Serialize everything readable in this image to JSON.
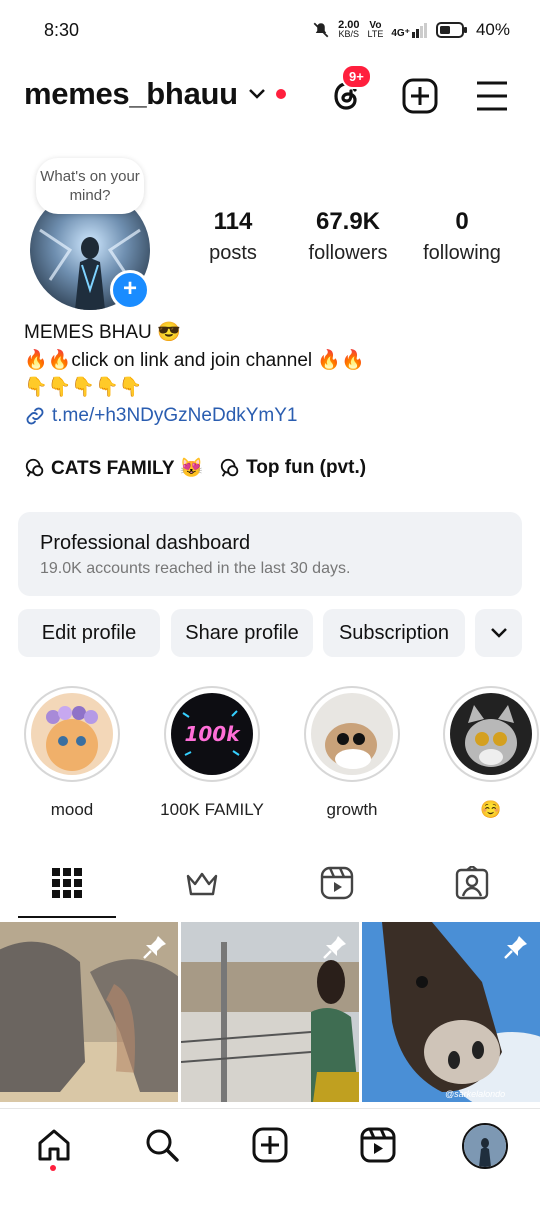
{
  "status_bar": {
    "time": "8:30",
    "speed_value": "2.00",
    "speed_unit": "KB/S",
    "volte_top": "Vo",
    "volte_bottom": "LTE",
    "network": "4G⁺",
    "battery": "40%"
  },
  "header": {
    "username": "memes_bhauu",
    "threads_badge": "9+",
    "icons": [
      "chevron-down-icon",
      "threads-icon",
      "add-post-icon",
      "menu-icon"
    ]
  },
  "profile": {
    "note_bubble": "What's on your mind?",
    "stats": [
      {
        "value": "114",
        "label": "posts"
      },
      {
        "value": "67.9K",
        "label": "followers"
      },
      {
        "value": "0",
        "label": "following"
      }
    ],
    "bio_name": "MEMES BHAU 😎",
    "bio_line1": "🔥🔥click on link and join channel 🔥🔥",
    "bio_line2": "👇👇👇👇👇",
    "bio_link": "t.me/+h3NDyGzNeDdkYmY1",
    "channels": [
      {
        "label": "CATS FAMILY 😻"
      },
      {
        "label": "Top fun (pvt.)"
      }
    ]
  },
  "dashboard": {
    "title": "Professional dashboard",
    "subtitle": "19.0K accounts reached in the last 30 days."
  },
  "actions": {
    "edit_label": "Edit profile",
    "share_label": "Share profile",
    "subscription_label": "Subscription"
  },
  "highlights": [
    {
      "label": "mood"
    },
    {
      "label": "100K FAMILY",
      "art_text": "100k"
    },
    {
      "label": "growth"
    },
    {
      "label": "☺️"
    }
  ],
  "tabs": [
    "grid-icon",
    "crown-icon",
    "reels-icon",
    "tagged-icon"
  ],
  "posts": [
    {
      "name": "elephants-post",
      "pinned": true
    },
    {
      "name": "girl-balcony-post",
      "pinned": true
    },
    {
      "name": "donkey-post",
      "pinned": true,
      "watermark": "@sarkelalondo"
    }
  ],
  "bottom_nav": [
    "home-icon",
    "search-icon",
    "create-icon",
    "reels-icon",
    "profile-avatar"
  ],
  "colors": {
    "accent_red": "#ff1f3d",
    "link_blue": "#2a5db0",
    "badge_blue": "#1a8cff",
    "panel_gray": "#f0f2f5"
  }
}
